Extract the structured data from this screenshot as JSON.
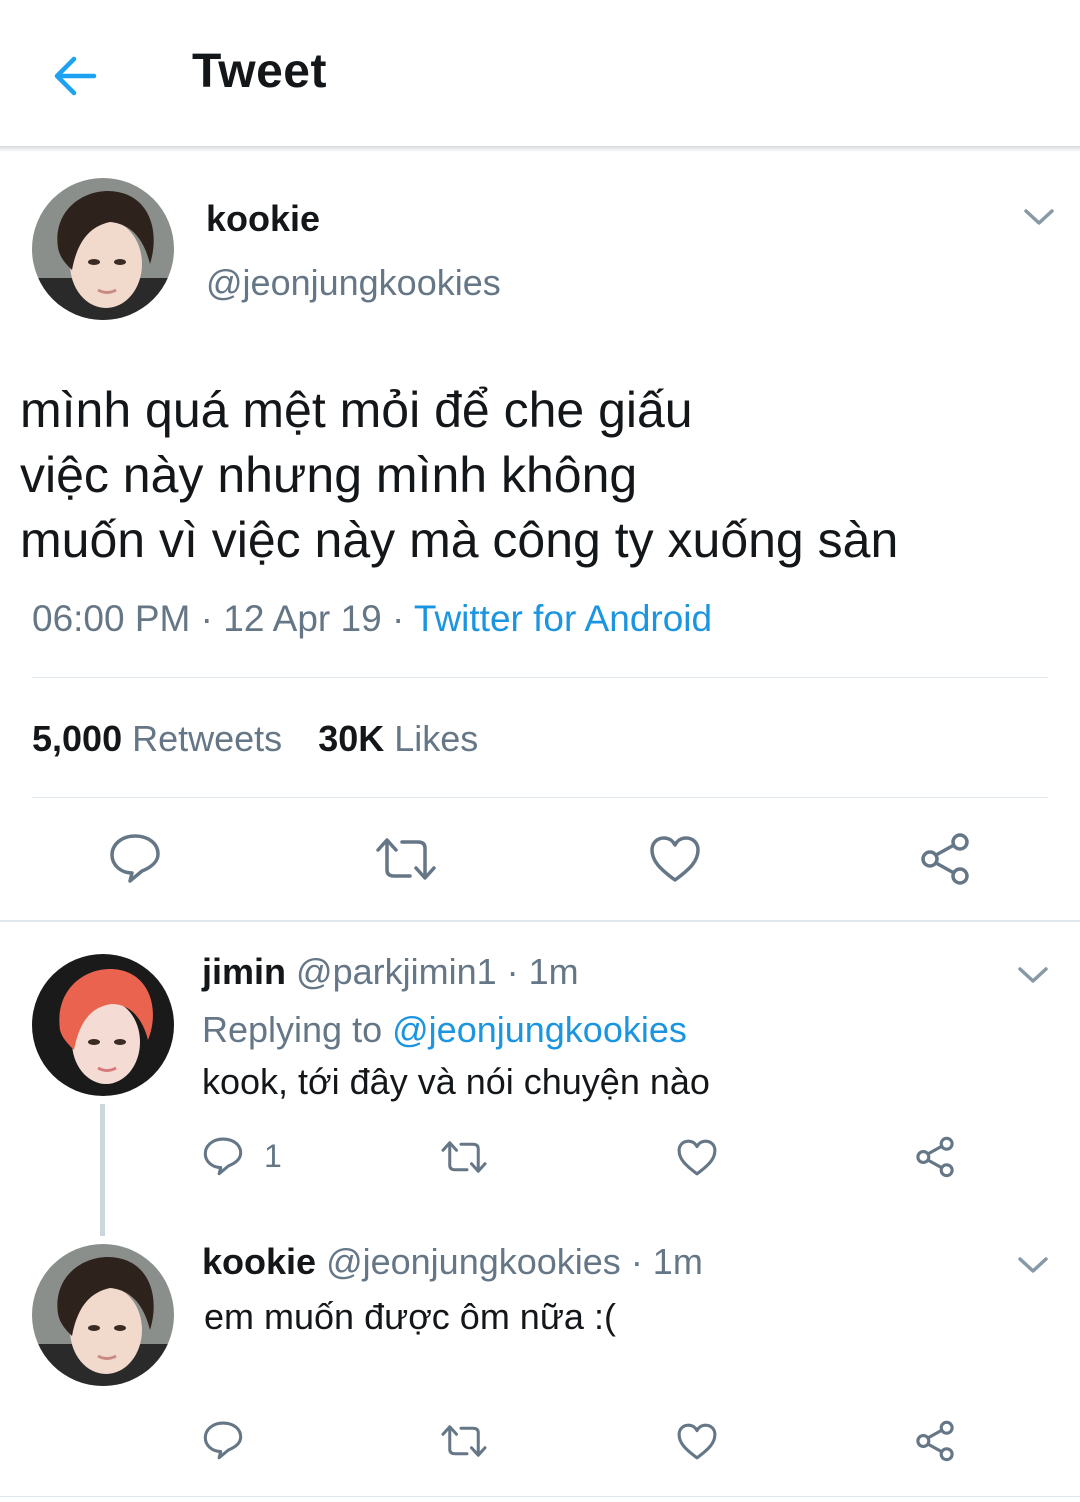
{
  "header": {
    "title": "Tweet"
  },
  "main_tweet": {
    "name": "kookie",
    "handle": "@jeonjungkookies",
    "text_lines": [
      "mình quá mệt mỏi để che giấu",
      "việc này nhưng mình không",
      "muốn vì việc này mà công ty xuống sàn"
    ],
    "time": "06:00 PM",
    "date": "12 Apr 19",
    "separator": "·",
    "source": "Twitter for Android",
    "retweets_count": "5,000",
    "retweets_label": "Retweets",
    "likes_count": "30K",
    "likes_label": "Likes"
  },
  "replies": [
    {
      "name": "jimin",
      "handle": "@parkjimin1",
      "time": "· 1m",
      "replying_prefix": "Replying to",
      "replying_to": "@jeonjungkookies",
      "text": "kook, tới đây và nói chuyện nào",
      "reply_count": "1"
    },
    {
      "name": "kookie",
      "handle": "@jeonjungkookies",
      "time": "· 1m",
      "text": "em muốn được ôm nữa :("
    }
  ],
  "colors": {
    "accent": "#1b95e0",
    "muted": "#657786",
    "text": "#14171a",
    "divider": "#e1e8ed"
  }
}
